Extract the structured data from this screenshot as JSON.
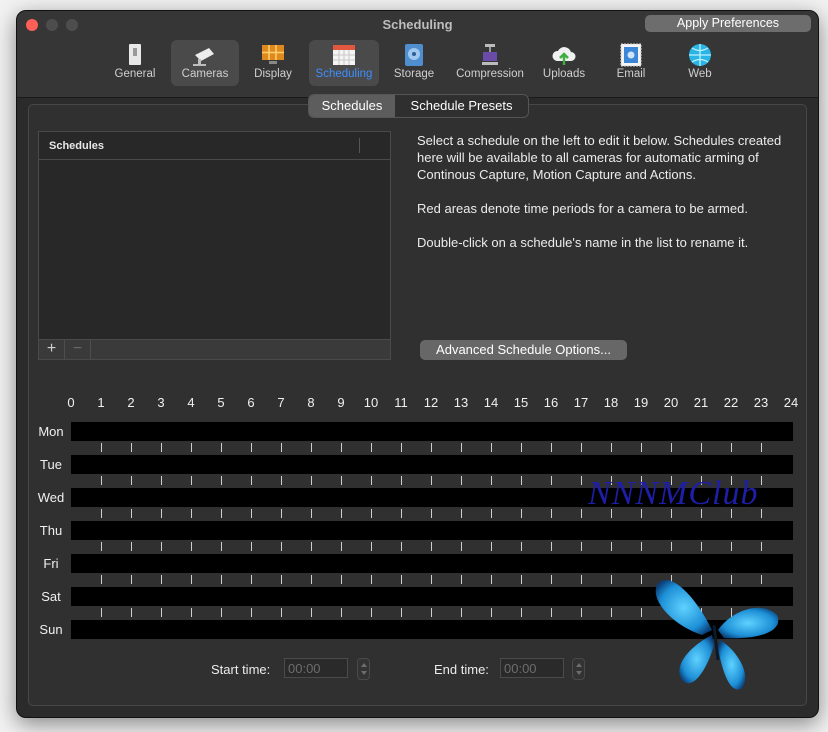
{
  "window": {
    "title": "Scheduling",
    "apply_label": "Apply Preferences"
  },
  "toolbar": {
    "items": [
      {
        "label": "General",
        "icon": "switch-icon"
      },
      {
        "label": "Cameras",
        "icon": "camera-icon"
      },
      {
        "label": "Display",
        "icon": "display-icon"
      },
      {
        "label": "Scheduling",
        "icon": "calendar-icon"
      },
      {
        "label": "Storage",
        "icon": "disk-icon"
      },
      {
        "label": "Compression",
        "icon": "vise-icon"
      },
      {
        "label": "Uploads",
        "icon": "cloud-upload-icon"
      },
      {
        "label": "Email",
        "icon": "stamp-icon"
      },
      {
        "label": "Web",
        "icon": "globe-icon"
      }
    ],
    "active": "Scheduling",
    "active_color": "#3d8eff"
  },
  "segment": {
    "tabs": [
      "Schedules",
      "Schedule Presets"
    ],
    "selected": "Schedules"
  },
  "schedules_table": {
    "header": "Schedules",
    "add_label": "+",
    "remove_label": "−"
  },
  "description": {
    "p1": "Select a schedule on the left to edit it below. Schedules created here will be available to all cameras for automatic arming of Continous Capture, Motion Capture and Actions.",
    "p2": "Red areas denote time periods for a camera to be armed.",
    "p3": "Double-click on a schedule's name in the list to rename it."
  },
  "advanced_button": "Advanced Schedule Options...",
  "grid": {
    "hours": [
      "0",
      "1",
      "2",
      "3",
      "4",
      "5",
      "6",
      "7",
      "8",
      "9",
      "10",
      "11",
      "12",
      "13",
      "14",
      "15",
      "16",
      "17",
      "18",
      "19",
      "20",
      "21",
      "22",
      "23",
      "24"
    ],
    "days": [
      "Mon",
      "Tue",
      "Wed",
      "Thu",
      "Fri",
      "Sat",
      "Sun"
    ]
  },
  "times": {
    "start_label": "Start time:",
    "start_placeholder": "00:00",
    "end_label": "End time:",
    "end_placeholder": "00:00"
  },
  "watermark": "NNNMClub"
}
